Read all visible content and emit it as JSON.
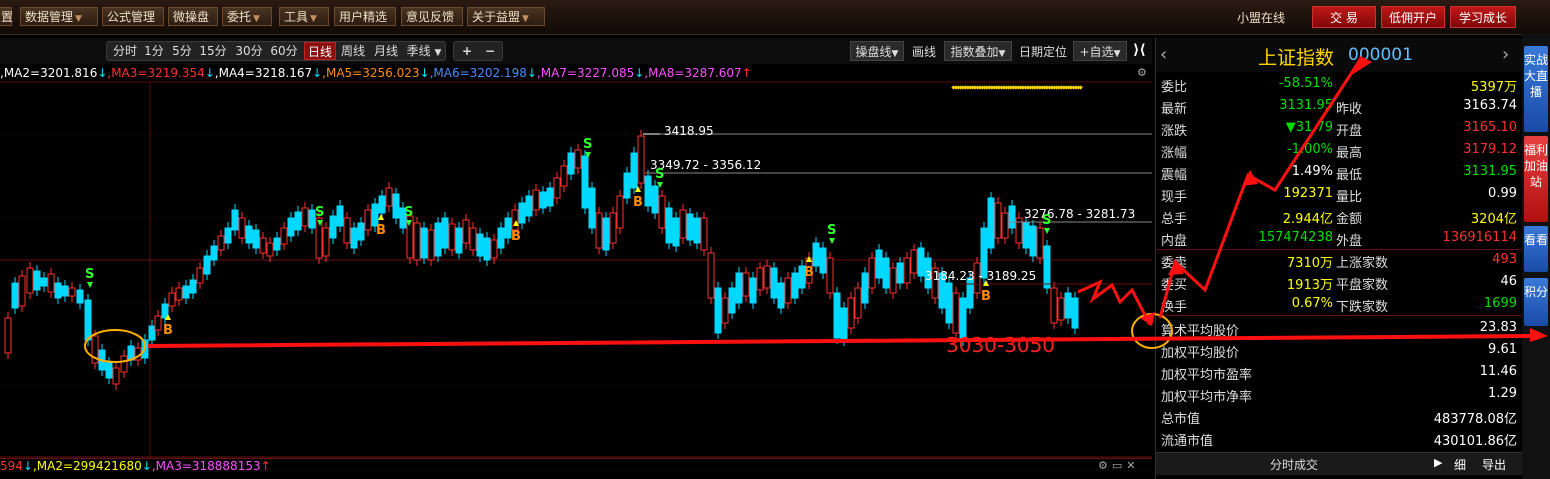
{
  "menubar": {
    "items": [
      {
        "label": "置",
        "arrow": false
      },
      {
        "label": "数据管理",
        "arrow": true
      },
      {
        "label": "公式管理",
        "arrow": false
      },
      {
        "label": "微操盘",
        "arrow": false
      },
      {
        "label": "委托",
        "arrow": true
      },
      {
        "label": "工具",
        "arrow": true
      },
      {
        "label": "用户精选",
        "arrow": false
      },
      {
        "label": "意见反馈",
        "arrow": false
      },
      {
        "label": "关于益盟",
        "arrow": true
      }
    ],
    "status_text": "小盟在线",
    "trade_button": "交 易",
    "margin_button": "低佣开户",
    "learn_button": "学习成长"
  },
  "period_bar": {
    "periods": [
      "分时",
      "1分",
      "5分",
      "15分",
      "30分",
      "60分",
      "日线",
      "周线",
      "月线",
      "季线"
    ],
    "active": "日线",
    "plus": "+",
    "minus": "−",
    "tools": [
      "操盘线",
      "画线",
      "指数叠加",
      "日期定位",
      "+自选"
    ]
  },
  "ma_line": [
    {
      "text": ",MA2=3201.816",
      "color": "#ffffff",
      "dir": "↓"
    },
    {
      "text": ",MA3=3219.354",
      "color": "#ff3030",
      "dir": "↓"
    },
    {
      "text": ",MA4=3218.167",
      "color": "#ffffff",
      "dir": "↓"
    },
    {
      "text": ",MA5=3256.023",
      "color": "#ff8c00",
      "dir": "↓"
    },
    {
      "text": ",MA6=3202.198",
      "color": "#4a8cff",
      "dir": "↓"
    },
    {
      "text": ",MA7=3227.085",
      "color": "#ff50ff",
      "dir": "↓"
    },
    {
      "text": ",MA8=3287.607",
      "color": "#ff50ff",
      "dir": "↑"
    }
  ],
  "vol_line": [
    {
      "text": "594",
      "color": "#ff3030",
      "dir": "↓"
    },
    {
      "text": ",MA2=299421680",
      "color": "#ffff00",
      "dir": "↓"
    },
    {
      "text": ",MA3=318888153",
      "color": "#ff50ff",
      "dir": "↑"
    }
  ],
  "annotations": {
    "high": "3418.95",
    "range1": "3349.72 - 3356.12",
    "range2": "3276.78 - 3281.73",
    "range3": "3184.23 - 3189.25",
    "target": "3030-3050",
    "s_label": "S",
    "b_label": "B"
  },
  "panel": {
    "name": "上证指数",
    "code": "000001",
    "rows_top": [
      {
        "label": "委比",
        "value": "-58.51%",
        "value_color": "#00e000",
        "label2": "",
        "value2": "5397万",
        "value2_color": "#ffff00"
      },
      {
        "label": "最新",
        "value": "3131.95",
        "value_color": "#00e000",
        "label2": "昨收",
        "value2": "3163.74",
        "value2_color": "#ffffff"
      },
      {
        "label": "涨跌",
        "value": "▼31.79",
        "value_color": "#00e000",
        "label2": "开盘",
        "value2": "3165.10",
        "value2_color": "#ff3030"
      },
      {
        "label": "涨幅",
        "value": "-1.00%",
        "value_color": "#00e000",
        "label2": "最高",
        "value2": "3179.12",
        "value2_color": "#ff3030"
      },
      {
        "label": "震幅",
        "value": "1.49%",
        "value_color": "#ffffff",
        "label2": "最低",
        "value2": "3131.95",
        "value2_color": "#00e000"
      },
      {
        "label": "现手",
        "value": "192371",
        "value_color": "#ffff00",
        "label2": "量比",
        "value2": "0.99",
        "value2_color": "#ffffff"
      },
      {
        "label": "总手",
        "value": "2.944亿",
        "value_color": "#ffff00",
        "label2": "金额",
        "value2": "3204亿",
        "value2_color": "#ffff00"
      },
      {
        "label": "内盘",
        "value": "157474238",
        "value_color": "#00e000",
        "label2": "外盘",
        "value2": "136916114",
        "value2_color": "#ff3030"
      }
    ],
    "rows_mid": [
      {
        "label": "委卖",
        "value": "7310万",
        "value_color": "#ffff00",
        "label2": "上涨家数",
        "value2": "493",
        "value2_color": "#ff3030"
      },
      {
        "label": "委买",
        "value": "1913万",
        "value_color": "#ffff00",
        "label2": "平盘家数",
        "value2": "46",
        "value2_color": "#ffffff"
      },
      {
        "label": "换手",
        "value": "0.67%",
        "value_color": "#ffff00",
        "label2": "下跌家数",
        "value2": "1699",
        "value2_color": "#00e000"
      }
    ],
    "rows_bottom": [
      {
        "label": "算术平均股价",
        "value": "23.83"
      },
      {
        "label": "加权平均股价",
        "value": "9.61"
      },
      {
        "label": "加权平均市盈率",
        "value": "11.46"
      },
      {
        "label": "加权平均市净率",
        "value": "1.29"
      },
      {
        "label": "总市值",
        "value": "483778.08亿"
      },
      {
        "label": "流通市值",
        "value": "430101.86亿"
      }
    ],
    "footer_title": "分时成交",
    "footer_detail": "细",
    "footer_export": "导出"
  },
  "right_tabs": [
    "实战大直播",
    "福利加油站",
    "看看",
    "积分"
  ],
  "chart_data": {
    "type": "candlestick",
    "title": "上证指数 日线",
    "annotated_levels": [
      {
        "label": "3418.95",
        "value": 3418.95
      },
      {
        "label": "3349.72 - 3356.12",
        "low": 3349.72,
        "high": 3356.12
      },
      {
        "label": "3276.78 - 3281.73",
        "low": 3276.78,
        "high": 3281.73
      },
      {
        "label": "3184.23 - 3189.25",
        "low": 3184.23,
        "high": 3189.25
      }
    ],
    "target_zone": "3030-3050",
    "last_close": 3131.95
  },
  "colors": {
    "up": "#ff3030",
    "down": "#00d8ff",
    "arrow": "#ff1010",
    "circle": "#ffb000"
  }
}
